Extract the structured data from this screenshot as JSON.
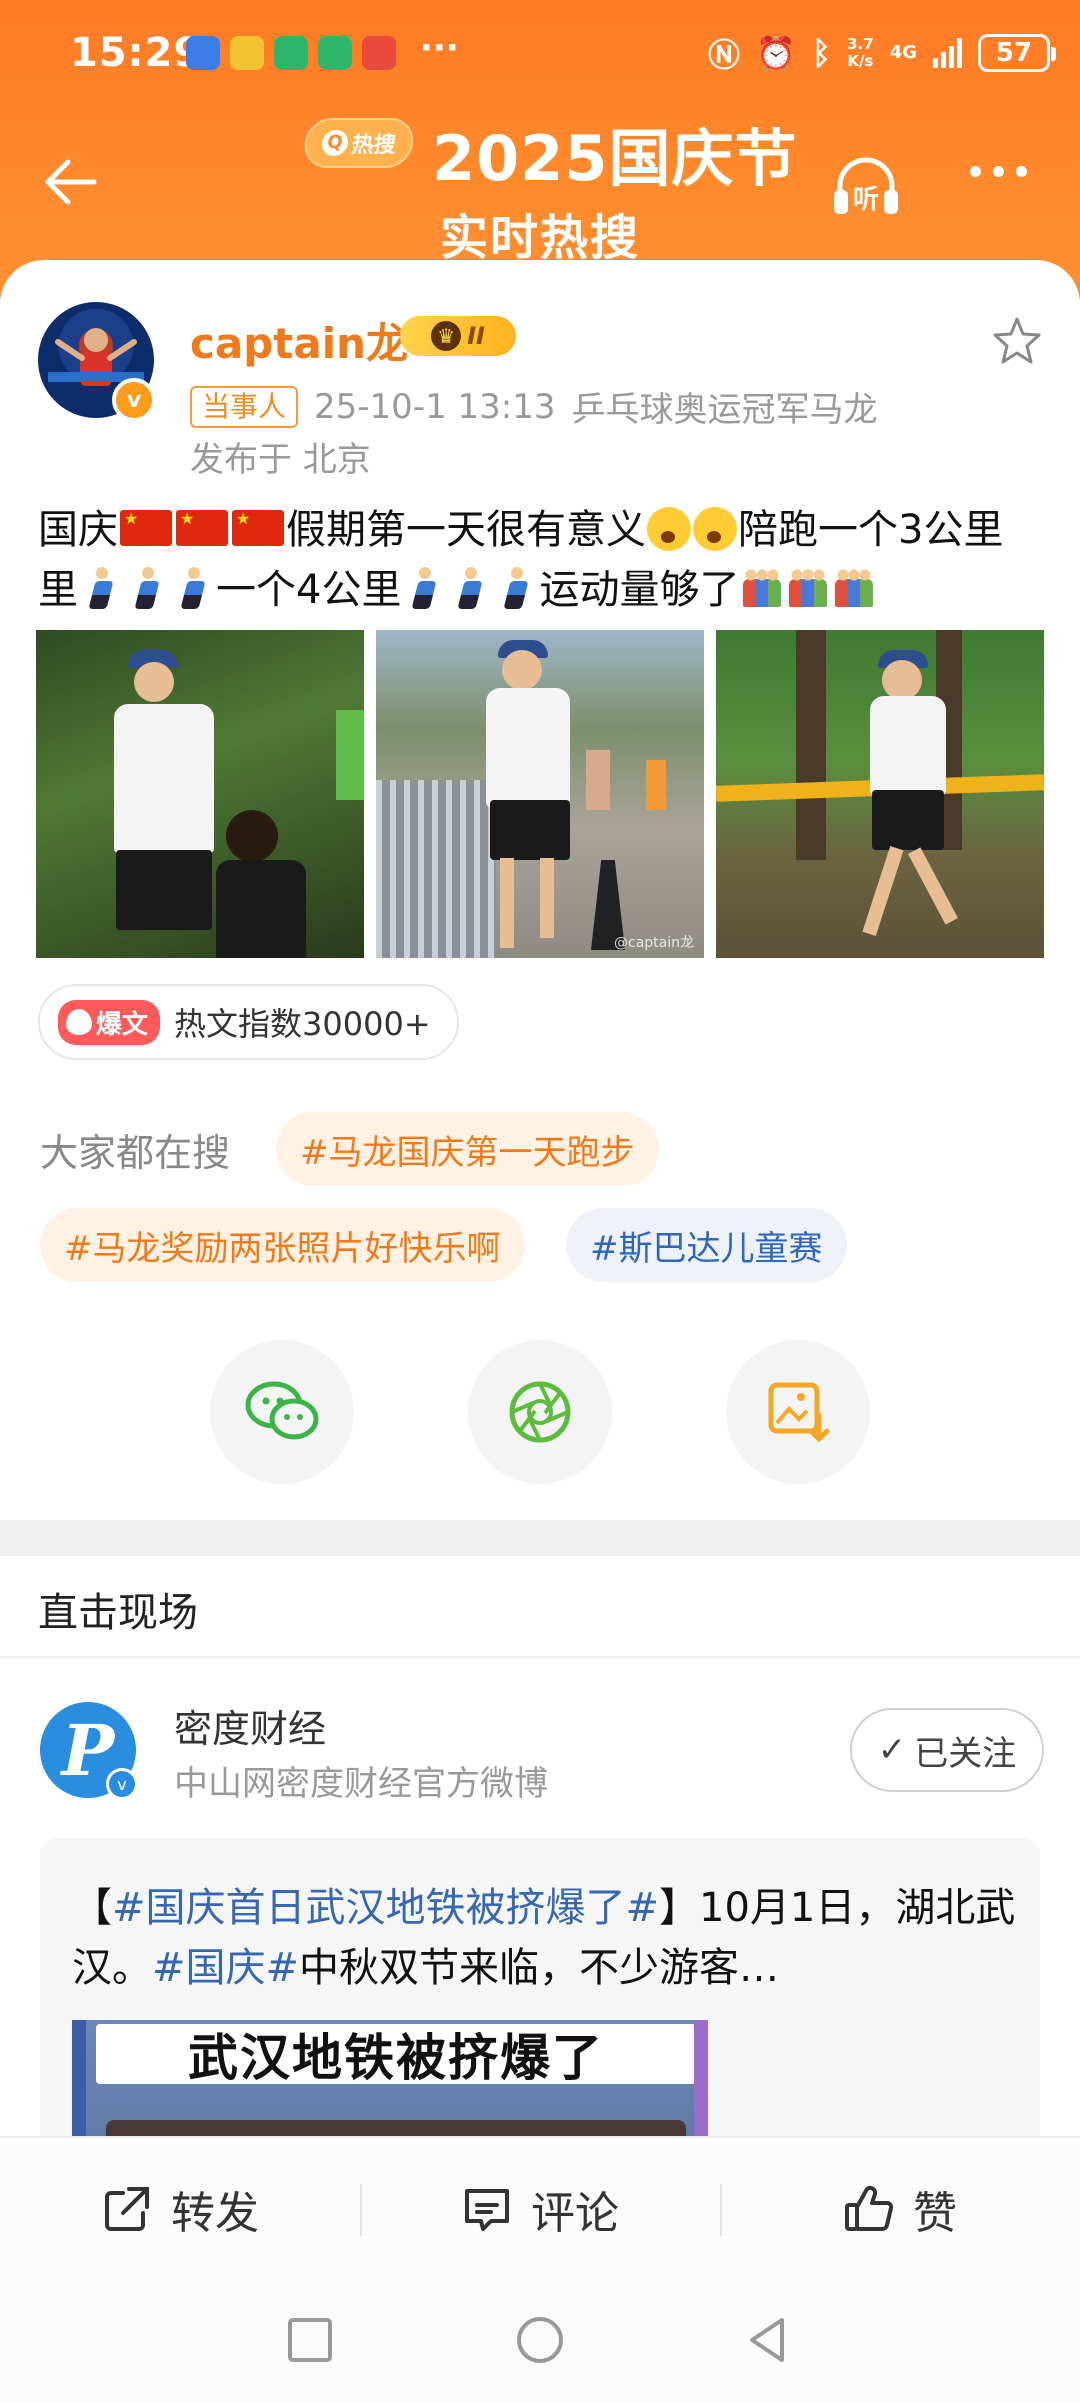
{
  "status_bar": {
    "time": "15:29",
    "more_indicator": "···",
    "net_speed_value": "3.7",
    "net_speed_unit": "K/s",
    "net_type": "4G",
    "battery": "57",
    "icons": [
      "nfc-icon",
      "alarm-icon",
      "bluetooth-icon",
      "signal-icon",
      "battery-icon"
    ]
  },
  "header": {
    "badge": "热搜",
    "title": "2025国庆节",
    "subtitle": "实时热搜",
    "listen_label": "听"
  },
  "post": {
    "author": "captain龙",
    "vip_level": "II",
    "role_tag": "当事人",
    "datetime": "25-10-1 13:13",
    "source": "乒乓球奥运冠军马龙",
    "location": "发布于 北京",
    "text_part1": "国庆",
    "text_part2": "假期第一天很有意义",
    "text_part3": "陪跑一个3公里",
    "text_part4": "一个4公里",
    "text_part5": "运动量够了",
    "photo_watermark": "@captain龙",
    "hot_tag": "爆文",
    "hot_index": "热文指数30000+",
    "search_label": "大家都在搜",
    "search_tags": [
      "#马龙国庆第一天跑步",
      "#马龙奖励两张照片好快乐啊",
      "#斯巴达儿童赛"
    ]
  },
  "section": {
    "title": "直击现场"
  },
  "feed": {
    "name": "密度财经",
    "desc": "中山网密度财经官方微博",
    "avatar_letter": "P",
    "follow_label": "已关注",
    "text_open": "【",
    "text_link1": "#国庆首日武汉地铁被挤爆了#",
    "text_close": "】10月1日，湖北武汉。",
    "text_link2": "#国庆#",
    "text_rest": "中秋双节来临，不少游客…",
    "thumb_title": "武汉地铁被挤爆了"
  },
  "actions": {
    "repost": "转发",
    "comment": "评论",
    "like": "赞"
  },
  "colors": {
    "header_orange": "#ff7a24",
    "accent_orange": "#f07a1a",
    "link_blue": "#3568b0"
  }
}
